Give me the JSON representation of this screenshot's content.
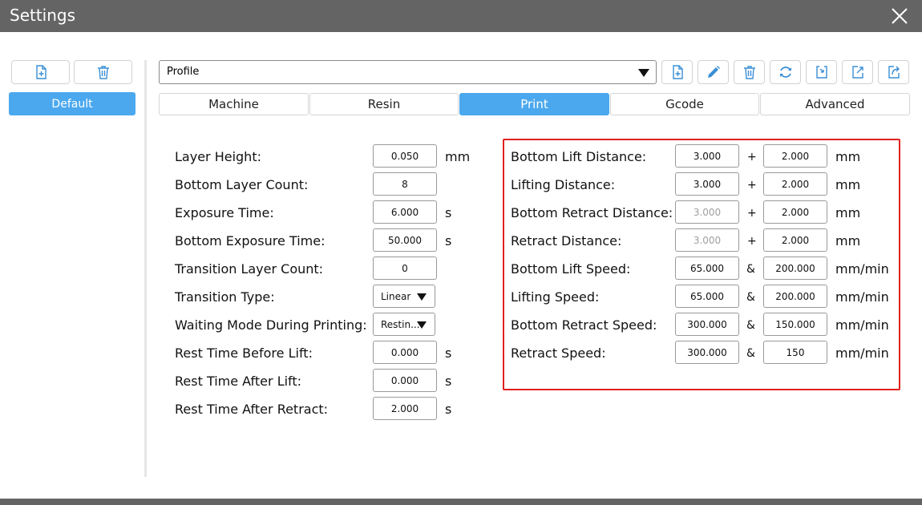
{
  "window": {
    "title": "Settings"
  },
  "profiles": {
    "items": [
      "Default"
    ]
  },
  "profile_select": {
    "value": "Profile"
  },
  "tabs": [
    "Machine",
    "Resin",
    "Print",
    "Gcode",
    "Advanced"
  ],
  "active_tab": "Print",
  "left_settings": [
    {
      "label": "Layer Height:",
      "value": "0.050",
      "unit": "mm"
    },
    {
      "label": "Bottom Layer Count:",
      "value": "8",
      "unit": ""
    },
    {
      "label": "Exposure Time:",
      "value": "6.000",
      "unit": "s"
    },
    {
      "label": "Bottom Exposure Time:",
      "value": "50.000",
      "unit": "s"
    },
    {
      "label": "Transition Layer Count:",
      "value": "0",
      "unit": ""
    },
    {
      "label": "Transition Type:",
      "value": "Linear",
      "unit": ""
    },
    {
      "label": "Waiting Mode During Printing:",
      "value": "Restin...",
      "unit": ""
    },
    {
      "label": "Rest Time Before Lift:",
      "value": "0.000",
      "unit": "s"
    },
    {
      "label": "Rest Time After Lift:",
      "value": "0.000",
      "unit": "s"
    },
    {
      "label": "Rest Time After Retract:",
      "value": "2.000",
      "unit": "s"
    }
  ],
  "right_settings": [
    {
      "label": "Bottom Lift Distance:",
      "value1": "3.000",
      "op": "+",
      "value2": "2.000",
      "unit": "mm"
    },
    {
      "label": "Lifting Distance:",
      "value1": "3.000",
      "op": "+",
      "value2": "2.000",
      "unit": "mm"
    },
    {
      "label": "Bottom Retract Distance:",
      "value1": "3.000",
      "op": "+",
      "value2": "2.000",
      "unit": "mm"
    },
    {
      "label": "Retract Distance:",
      "value1": "3.000",
      "op": "+",
      "value2": "2.000",
      "unit": "mm"
    },
    {
      "label": "Bottom Lift Speed:",
      "value1": "65.000",
      "op": "&",
      "value2": "200.000",
      "unit": "mm/min"
    },
    {
      "label": "Lifting Speed:",
      "value1": "65.000",
      "op": "&",
      "value2": "200.000",
      "unit": "mm/min"
    },
    {
      "label": "Bottom Retract Speed:",
      "value1": "300.000",
      "op": "&",
      "value2": "150.000",
      "unit": "mm/min"
    },
    {
      "label": "Retract Speed:",
      "value1": "300.000",
      "op": "&",
      "value2": "150",
      "unit": "mm/min"
    }
  ],
  "icons": {
    "profile_toolbar": [
      "add-file-icon",
      "delete-icon"
    ],
    "toolbar": [
      "add-file-icon",
      "edit-icon",
      "delete-icon",
      "refresh-icon",
      "import-icon",
      "export-icon",
      "share-icon"
    ]
  },
  "colors": {
    "accent": "#4ba8ee",
    "titlebar": "#646464",
    "highlight": "#e02020"
  }
}
